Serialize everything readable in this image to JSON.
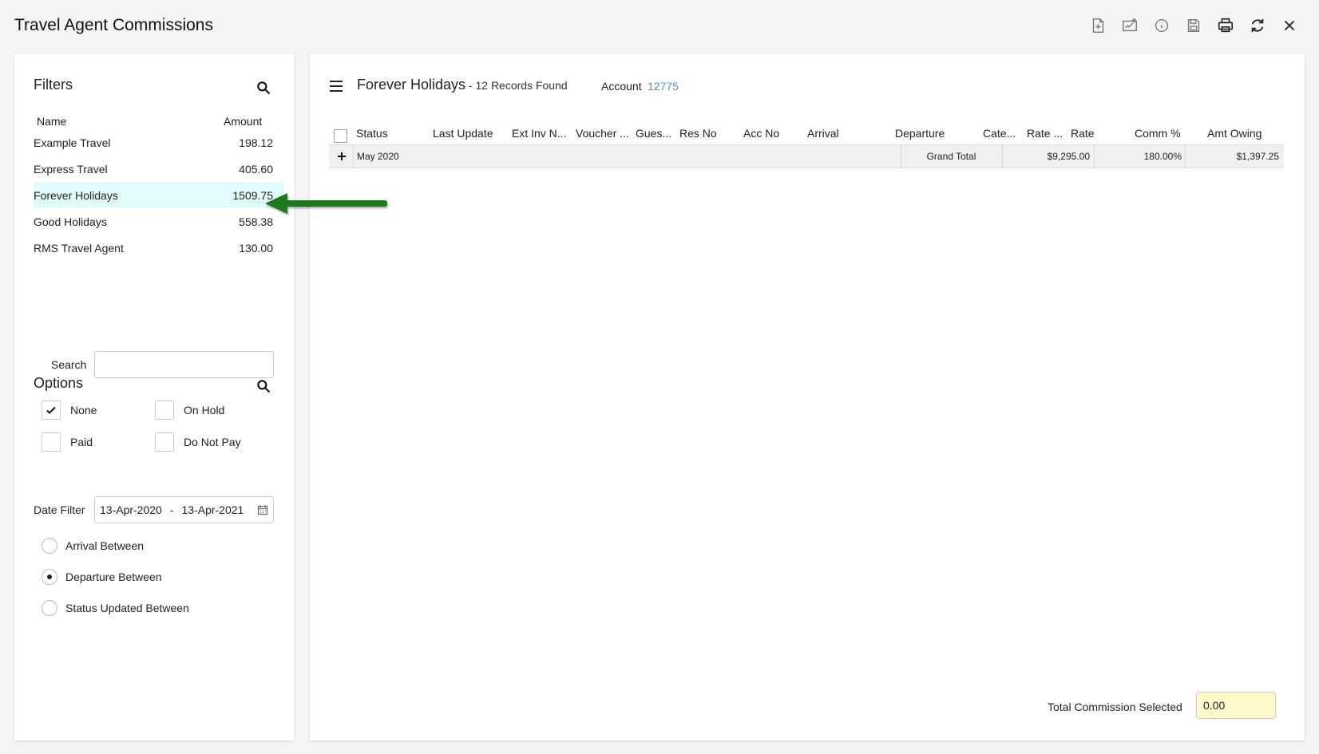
{
  "window": {
    "title": "Travel Agent Commissions"
  },
  "toolbar": {
    "icons": [
      "add-document-icon",
      "edit-form-icon",
      "info-icon",
      "save-icon",
      "print-icon",
      "refresh-icon",
      "close-icon"
    ]
  },
  "filters": {
    "title": "Filters",
    "col_name": "Name",
    "col_amount": "Amount",
    "items": [
      {
        "name": "Example Travel",
        "amount": "198.12"
      },
      {
        "name": "Express Travel",
        "amount": "405.60"
      },
      {
        "name": "Forever Holidays",
        "amount": "1509.75"
      },
      {
        "name": "Good Holidays",
        "amount": "558.38"
      },
      {
        "name": "RMS Travel Agent",
        "amount": "130.00"
      }
    ],
    "search_label": "Search",
    "search_value": ""
  },
  "options": {
    "title": "Options",
    "checkboxes": [
      {
        "label": "None",
        "checked": true
      },
      {
        "label": "On Hold",
        "checked": false
      },
      {
        "label": "Paid",
        "checked": false
      },
      {
        "label": "Do Not Pay",
        "checked": false
      }
    ],
    "date_filter_label": "Date Filter",
    "date_from": "13-Apr-2020",
    "date_sep": "-",
    "date_to": "13-Apr-2021",
    "radios": [
      {
        "label": "Arrival Between",
        "selected": false
      },
      {
        "label": "Departure Between",
        "selected": true
      },
      {
        "label": "Status Updated Between",
        "selected": false
      }
    ]
  },
  "main": {
    "agent_name": "Forever Holidays",
    "records_text": " - 12 Records Found",
    "account_label": "Account",
    "account_value": "12775",
    "columns": [
      "Status",
      "Last Update",
      "Ext Inv N...",
      "Voucher ...",
      "Gues...",
      "Res No",
      "Acc No",
      "Arrival",
      "Departure",
      "Cate...",
      "Rate ...",
      "Rate",
      "Comm %",
      "Amt Owing"
    ],
    "group_row": {
      "label": "May 2020",
      "total_label": "Grand Total",
      "rate": "$9,295.00",
      "comm": "180.00%",
      "owing": "$1,397.25"
    },
    "total_label": "Total Commission Selected",
    "total_value": "0.00"
  },
  "colors": {
    "selected_row": "#e2fbfb",
    "account_link": "#5a8fc6",
    "arrow": "#1f7a1f",
    "total_bg": "#fff9cc"
  }
}
